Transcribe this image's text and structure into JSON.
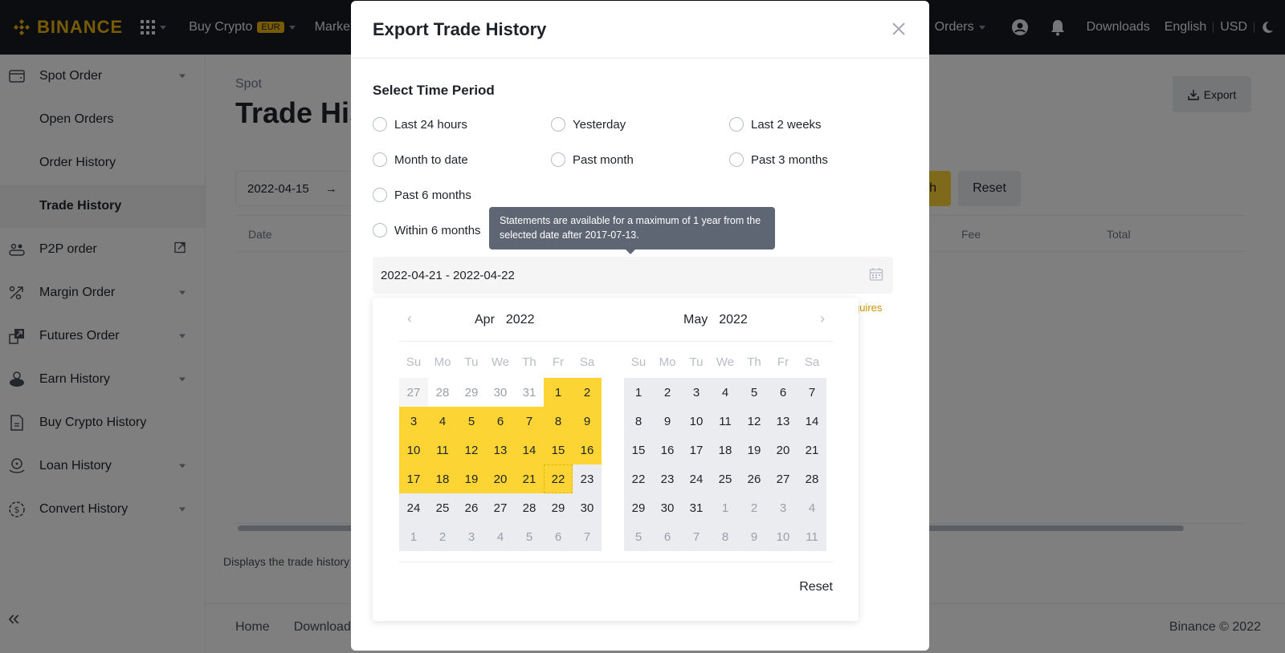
{
  "topbar": {
    "brand": "BINANCE",
    "nav": [
      {
        "label": "Buy Crypto",
        "badge": "EUR"
      },
      {
        "label": "Markets"
      }
    ],
    "right": {
      "orders": "Orders",
      "downloads": "Downloads",
      "language": "English",
      "currency": "USD"
    }
  },
  "sidebar": {
    "items": [
      {
        "label": "Spot Order",
        "icon": "wallet-icon",
        "expandable": true
      },
      {
        "label": "Open Orders",
        "sub": true
      },
      {
        "label": "Order History",
        "sub": true
      },
      {
        "label": "Trade History",
        "sub": true,
        "active": true
      },
      {
        "label": "P2P order",
        "icon": "p2p-icon",
        "external": true
      },
      {
        "label": "Margin Order",
        "icon": "margin-icon",
        "expandable": true
      },
      {
        "label": "Futures Order",
        "icon": "futures-icon",
        "expandable": true
      },
      {
        "label": "Earn History",
        "icon": "piggy-bank-icon",
        "expandable": true
      },
      {
        "label": "Buy Crypto History",
        "icon": "document-icon",
        "expandable": false
      },
      {
        "label": "Loan History",
        "icon": "loan-icon",
        "expandable": true
      },
      {
        "label": "Convert History",
        "icon": "convert-icon",
        "expandable": true
      }
    ],
    "collapse_label": "«"
  },
  "main": {
    "breadcrumb": "Spot",
    "title": "Trade History",
    "export_label": "Export",
    "date_from": "2022-04-15",
    "arrow": "→",
    "search_label": "Search",
    "reset_label": "Reset",
    "columns": {
      "date": "Date",
      "fee": "Fee",
      "total": "Total"
    },
    "note": "Displays the trade history",
    "footer_links": [
      "Home",
      "Download"
    ],
    "copyright": "Binance © 2022"
  },
  "modal": {
    "title": "Export Trade History",
    "section_label": "Select Time Period",
    "options": [
      "Last 24 hours",
      "Yesterday",
      "Last 2 weeks",
      "Month to date",
      "Past month",
      "Past 3 months",
      "Past 6 months",
      "Within 6 months"
    ],
    "tooltip": "Statements are available for a maximum of 1 year from the selected date after 2017-07-13.",
    "range_value": "2022-04-21 - 2022-04-22",
    "hint_fragment": "quires",
    "picker": {
      "left": {
        "month": "Apr",
        "year": "2022"
      },
      "right": {
        "month": "May",
        "year": "2022"
      },
      "weekdays": [
        "Su",
        "Mo",
        "Tu",
        "We",
        "Th",
        "Fr",
        "Sa"
      ],
      "left_days": [
        [
          27,
          "other-light"
        ],
        [
          28,
          "other"
        ],
        [
          29,
          "other"
        ],
        [
          30,
          "other"
        ],
        [
          31,
          "other"
        ],
        [
          1,
          "range"
        ],
        [
          2,
          "range"
        ],
        [
          3,
          "range"
        ],
        [
          4,
          "range"
        ],
        [
          5,
          "range"
        ],
        [
          6,
          "range"
        ],
        [
          7,
          "range"
        ],
        [
          8,
          "range"
        ],
        [
          9,
          "range"
        ],
        [
          10,
          "range"
        ],
        [
          11,
          "range"
        ],
        [
          12,
          "range"
        ],
        [
          13,
          "range"
        ],
        [
          14,
          "range"
        ],
        [
          15,
          "range"
        ],
        [
          16,
          "range"
        ],
        [
          17,
          "range"
        ],
        [
          18,
          "range"
        ],
        [
          19,
          "range"
        ],
        [
          20,
          "range"
        ],
        [
          21,
          "range"
        ],
        [
          22,
          "end"
        ],
        [
          23,
          "bg"
        ],
        [
          24,
          "bg"
        ],
        [
          25,
          "bg"
        ],
        [
          26,
          "bg"
        ],
        [
          27,
          "bg"
        ],
        [
          28,
          "bg"
        ],
        [
          29,
          "bg"
        ],
        [
          30,
          "bg"
        ],
        [
          1,
          "bg-other"
        ],
        [
          2,
          "bg-other"
        ],
        [
          3,
          "bg-other"
        ],
        [
          4,
          "bg-other"
        ],
        [
          5,
          "bg-other"
        ],
        [
          6,
          "bg-other"
        ],
        [
          7,
          "bg-other"
        ]
      ],
      "right_days": [
        [
          1,
          "bg"
        ],
        [
          2,
          "bg"
        ],
        [
          3,
          "bg"
        ],
        [
          4,
          "bg"
        ],
        [
          5,
          "bg"
        ],
        [
          6,
          "bg"
        ],
        [
          7,
          "bg"
        ],
        [
          8,
          "bg"
        ],
        [
          9,
          "bg"
        ],
        [
          10,
          "bg"
        ],
        [
          11,
          "bg"
        ],
        [
          12,
          "bg"
        ],
        [
          13,
          "bg"
        ],
        [
          14,
          "bg"
        ],
        [
          15,
          "bg"
        ],
        [
          16,
          "bg"
        ],
        [
          17,
          "bg"
        ],
        [
          18,
          "bg"
        ],
        [
          19,
          "bg"
        ],
        [
          20,
          "bg"
        ],
        [
          21,
          "bg"
        ],
        [
          22,
          "bg"
        ],
        [
          23,
          "bg"
        ],
        [
          24,
          "bg"
        ],
        [
          25,
          "bg"
        ],
        [
          26,
          "bg"
        ],
        [
          27,
          "bg"
        ],
        [
          28,
          "bg"
        ],
        [
          29,
          "bg"
        ],
        [
          30,
          "bg"
        ],
        [
          31,
          "bg"
        ],
        [
          1,
          "bg-other"
        ],
        [
          2,
          "bg-other"
        ],
        [
          3,
          "bg-other"
        ],
        [
          4,
          "bg-other"
        ],
        [
          5,
          "bg-other"
        ],
        [
          6,
          "bg-other"
        ],
        [
          7,
          "bg-other"
        ],
        [
          8,
          "bg-other"
        ],
        [
          9,
          "bg-other"
        ],
        [
          10,
          "bg-other"
        ],
        [
          11,
          "bg-other"
        ]
      ],
      "reset_label": "Reset"
    }
  },
  "colors": {
    "brand": "#f0b90b",
    "range": "#fcd535",
    "topbar": "#181a20"
  }
}
